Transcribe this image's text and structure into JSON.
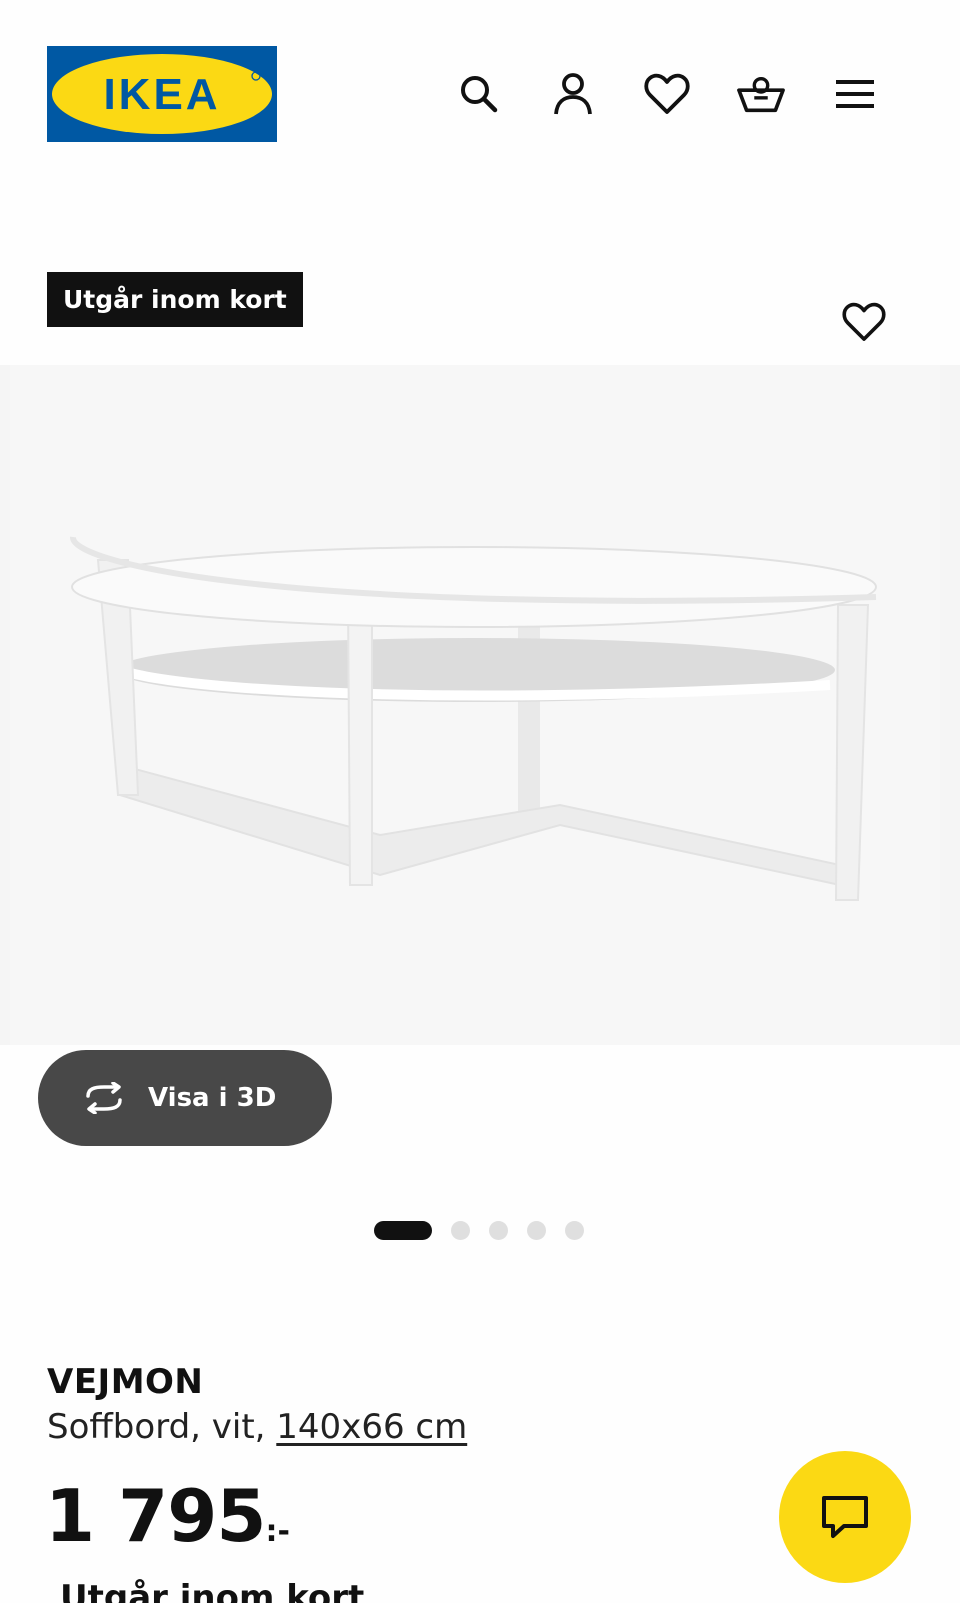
{
  "header": {
    "logo_text": "IKEA",
    "nav": [
      {
        "icon": "search-icon"
      },
      {
        "icon": "user-icon"
      },
      {
        "icon": "heart-icon"
      },
      {
        "icon": "basket-icon"
      },
      {
        "icon": "menu-icon"
      }
    ]
  },
  "product": {
    "badge": "Utgår inom kort",
    "view3d_label": "Visa i 3D",
    "gallery": {
      "count": 5,
      "active_index": 0
    },
    "name": "VEJMON",
    "desc_prefix": "Soffbord, vit, ",
    "size_link": "140x66 cm",
    "price_main": "1 795",
    "price_suffix": ":-",
    "status_line": "Utgår inom kort"
  },
  "colors": {
    "ikea_blue": "#0058a3",
    "ikea_yellow": "#fbd914",
    "badge_bg": "#111111",
    "view3d_bg": "#484848"
  }
}
